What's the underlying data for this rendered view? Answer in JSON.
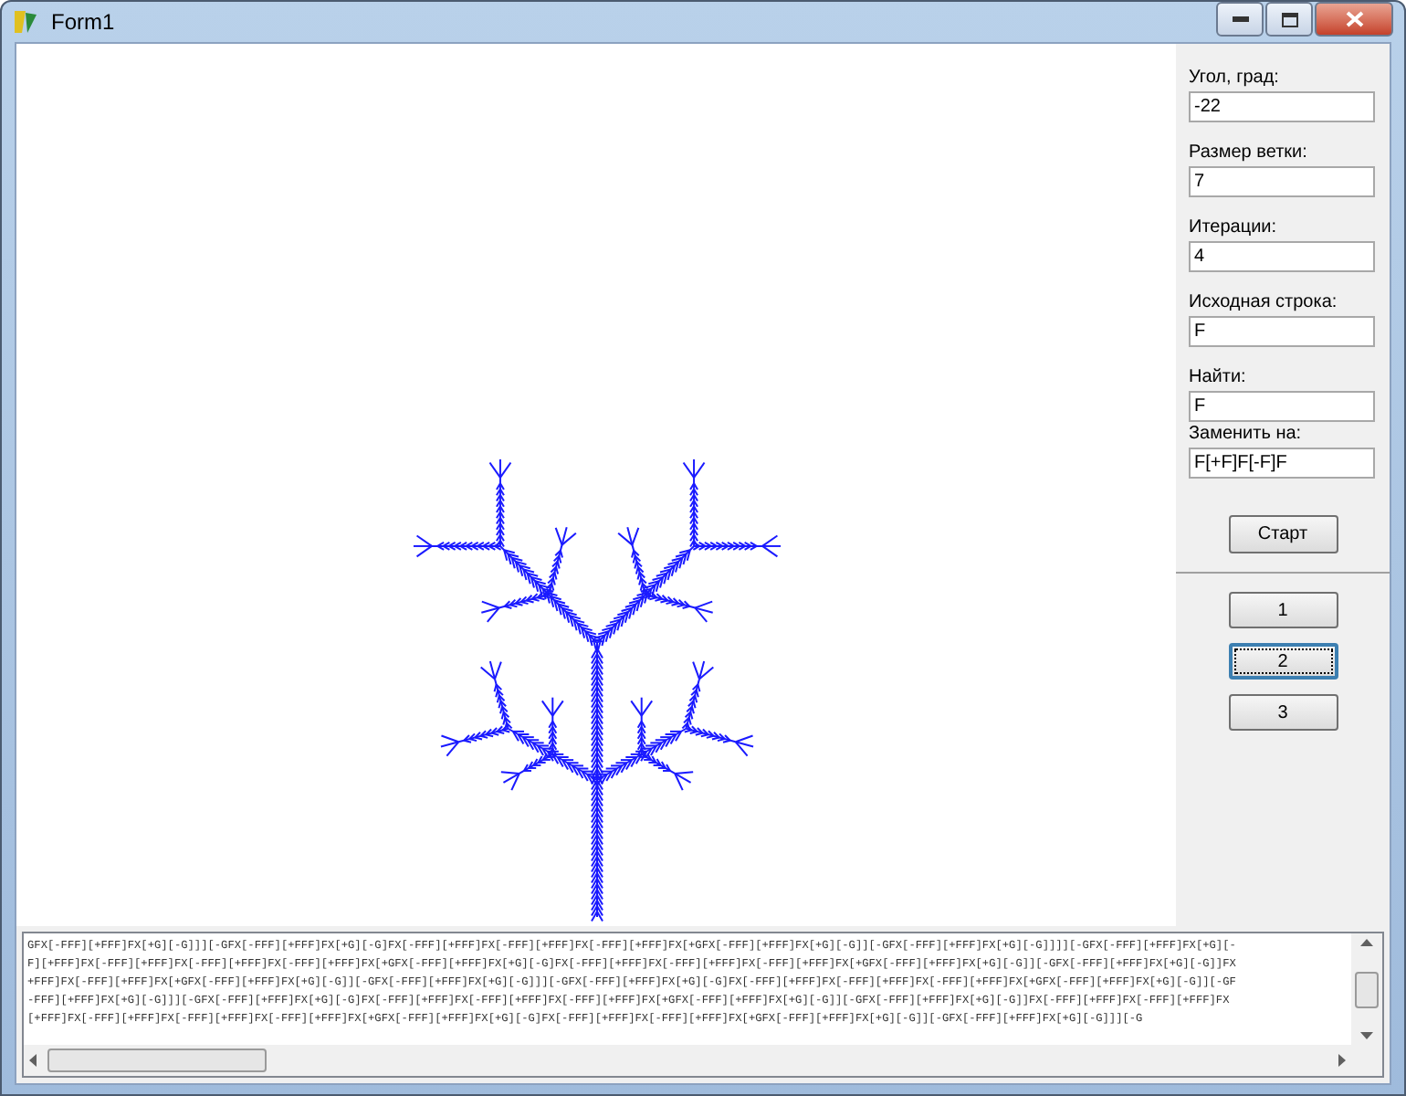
{
  "window": {
    "title": "Form1"
  },
  "fields": [
    {
      "label": "Угол, град:",
      "value": "-22"
    },
    {
      "label": "Размер ветки:",
      "value": "7"
    },
    {
      "label": "Итерации:",
      "value": "4"
    },
    {
      "label": "Исходная строка:",
      "value": "F"
    },
    {
      "label": "Найти:",
      "value": "F"
    },
    {
      "label": "Заменить на:",
      "value": "F[+F]F[-F]F"
    }
  ],
  "start_button": "Старт",
  "number_buttons": [
    {
      "label": "1",
      "focused": false
    },
    {
      "label": "2",
      "focused": true
    },
    {
      "label": "3",
      "focused": false
    }
  ],
  "output_lines": [
    "GFX[-FFF][+FFF]FX[+G][-G]]][-GFX[-FFF][+FFF]FX[+G][-G]FX[-FFF][+FFF]FX[-FFF][+FFF]FX[-FFF][+FFF]FX[+GFX[-FFF][+FFF]FX[+G][-G]][-GFX[-FFF][+FFF]FX[+G][-G]]]][-GFX[-FFF][+FFF]FX[+G][-",
    "F][+FFF]FX[-FFF][+FFF]FX[-FFF][+FFF]FX[-FFF][+FFF]FX[+GFX[-FFF][+FFF]FX[+G][-G]FX[-FFF][+FFF]FX[-FFF][+FFF]FX[-FFF][+FFF]FX[+GFX[-FFF][+FFF]FX[+G][-G]][-GFX[-FFF][+FFF]FX[+G][-G]]FX",
    "+FFF]FX[-FFF][+FFF]FX[+GFX[-FFF][+FFF]FX[+G][-G]][-GFX[-FFF][+FFF]FX[+G][-G]]][-GFX[-FFF][+FFF]FX[+G][-G]FX[-FFF][+FFF]FX[-FFF][+FFF]FX[-FFF][+FFF]FX[+GFX[-FFF][+FFF]FX[+G][-G]][-GF",
    "-FFF][+FFF]FX[+G][-G]]][-GFX[-FFF][+FFF]FX[+G][-G]FX[-FFF][+FFF]FX[-FFF][+FFF]FX[-FFF][+FFF]FX[+GFX[-FFF][+FFF]FX[+G][-G]][-GFX[-FFF][+FFF]FX[+G][-G]]FX[-FFF][+FFF]FX[-FFF][+FFF]FX",
    "[+FFF]FX[-FFF][+FFF]FX[-FFF][+FFF]FX[-FFF][+FFF]FX[+GFX[-FFF][+FFF]FX[+G][-G]FX[-FFF][+FFF]FX[-FFF][+FFF]FX[+GFX[-FFF][+FFF]FX[+G][-G]][-GFX[-FFF][+FFF]FX[+G][-G]]][-G"
  ]
}
